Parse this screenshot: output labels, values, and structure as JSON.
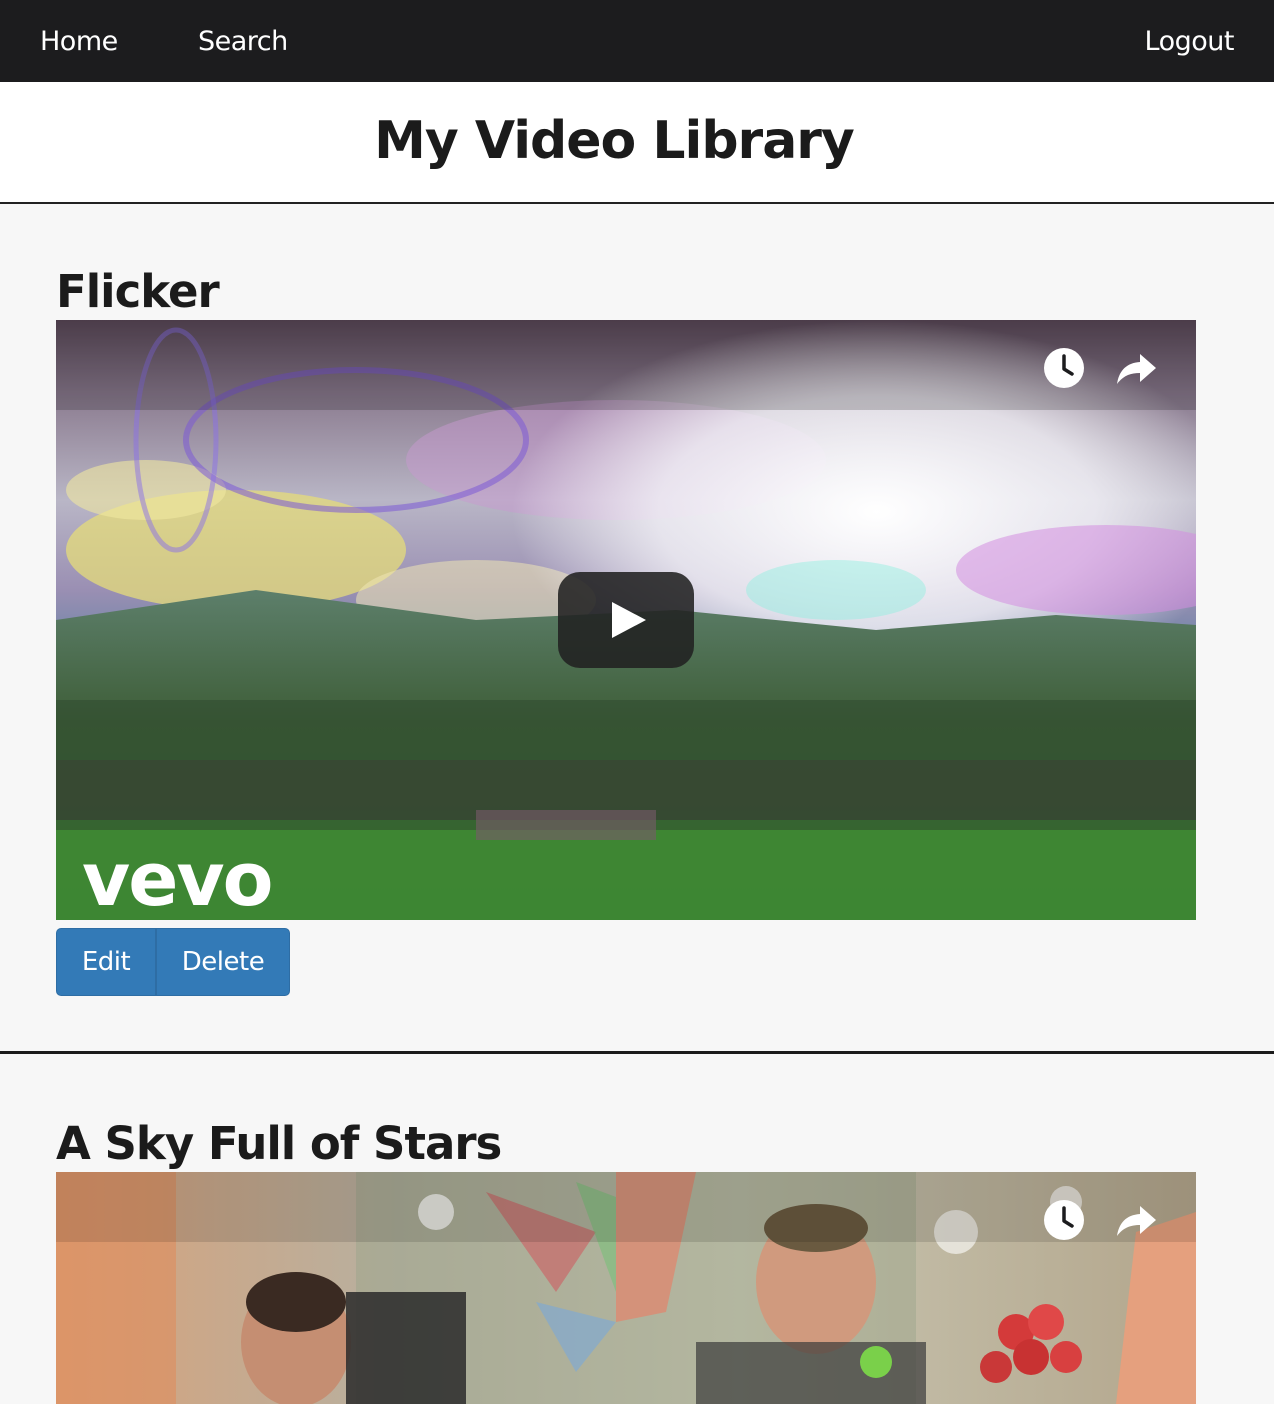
{
  "nav": {
    "home": "Home",
    "search": "Search",
    "logout": "Logout"
  },
  "page_title": "My Video Library",
  "videos": [
    {
      "title": "Flicker",
      "watermark": "vevo",
      "thumbnail": "dreamy sky over green valley landscape",
      "actions": {
        "edit": "Edit",
        "delete": "Delete"
      }
    },
    {
      "title": "A Sky Full of Stars",
      "thumbnail": "band performing with confetti and flowers"
    }
  ],
  "icons": {
    "play": "play-icon",
    "watch_later": "clock-icon",
    "share": "share-icon"
  },
  "colors": {
    "navbar": "#1c1c1e",
    "button": "#337ab7",
    "background": "#f7f7f7"
  }
}
